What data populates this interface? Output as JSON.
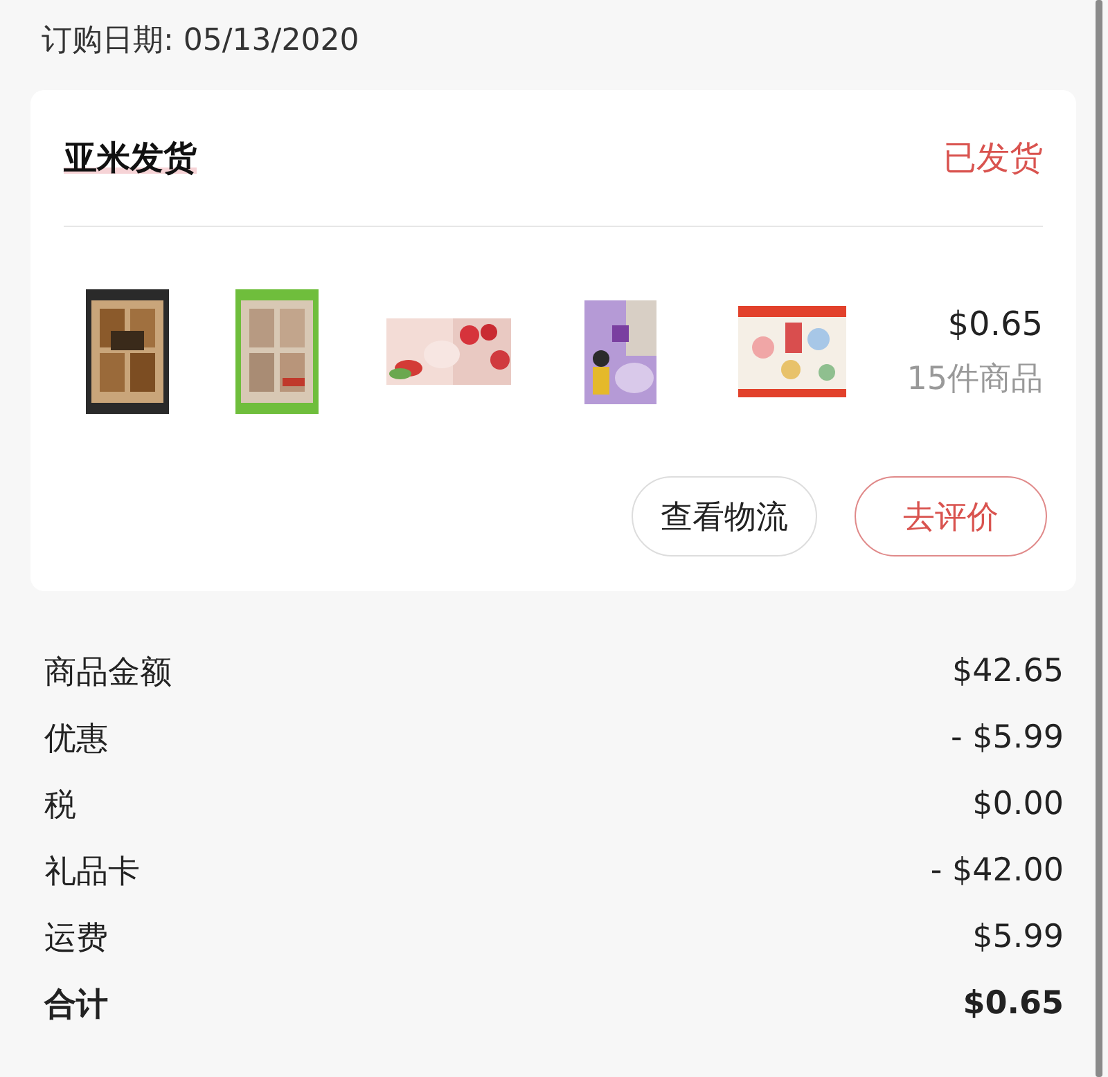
{
  "order_date": "订购日期: 05/13/2020",
  "shipment": {
    "title": "亚米发货",
    "status": "已发货",
    "price": "$0.65",
    "count": "15件商品",
    "buttons": [
      {
        "label": "查看物流",
        "kind": "plain"
      },
      {
        "label": "去评价",
        "kind": "accent"
      }
    ]
  },
  "summary": [
    {
      "label": "商品金额",
      "value": "$42.65",
      "bold": false
    },
    {
      "label": "优惠",
      "value": "- $5.99",
      "bold": false
    },
    {
      "label": "税",
      "value": "$0.00",
      "bold": false
    },
    {
      "label": "礼品卡",
      "value": "- $42.00",
      "bold": false
    },
    {
      "label": "运费",
      "value": "$5.99",
      "bold": false
    },
    {
      "label": "合计",
      "value": "$0.65",
      "bold": true
    }
  ]
}
